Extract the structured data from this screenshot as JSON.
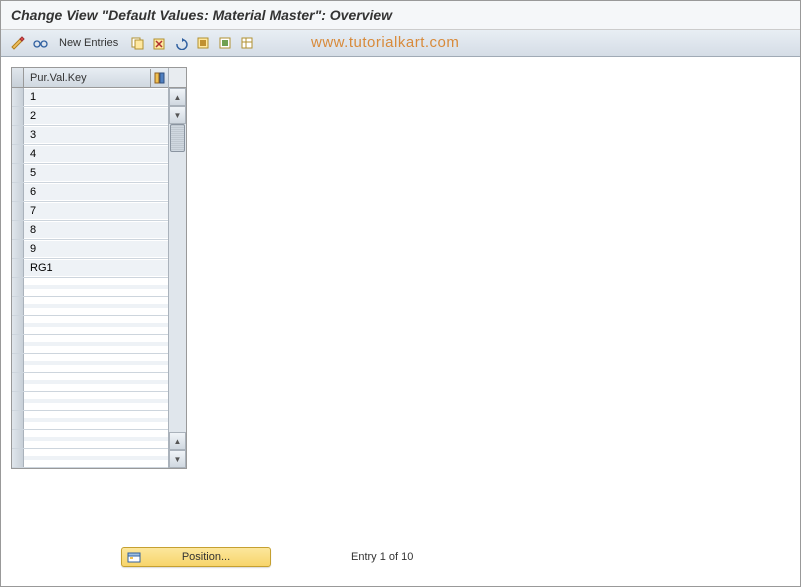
{
  "header": {
    "title": "Change View \"Default Values: Material Master\": Overview"
  },
  "toolbar": {
    "new_entries_label": "New Entries",
    "watermark": "www.tutorialkart.com"
  },
  "table": {
    "column_header": "Pur.Val.Key",
    "rows": [
      "1",
      "2",
      "3",
      "4",
      "5",
      "6",
      "7",
      "8",
      "9",
      "RG1",
      "",
      "",
      "",
      "",
      "",
      "",
      "",
      "",
      "",
      ""
    ]
  },
  "footer": {
    "position_label": "Position...",
    "entry_status": "Entry 1 of 10"
  }
}
